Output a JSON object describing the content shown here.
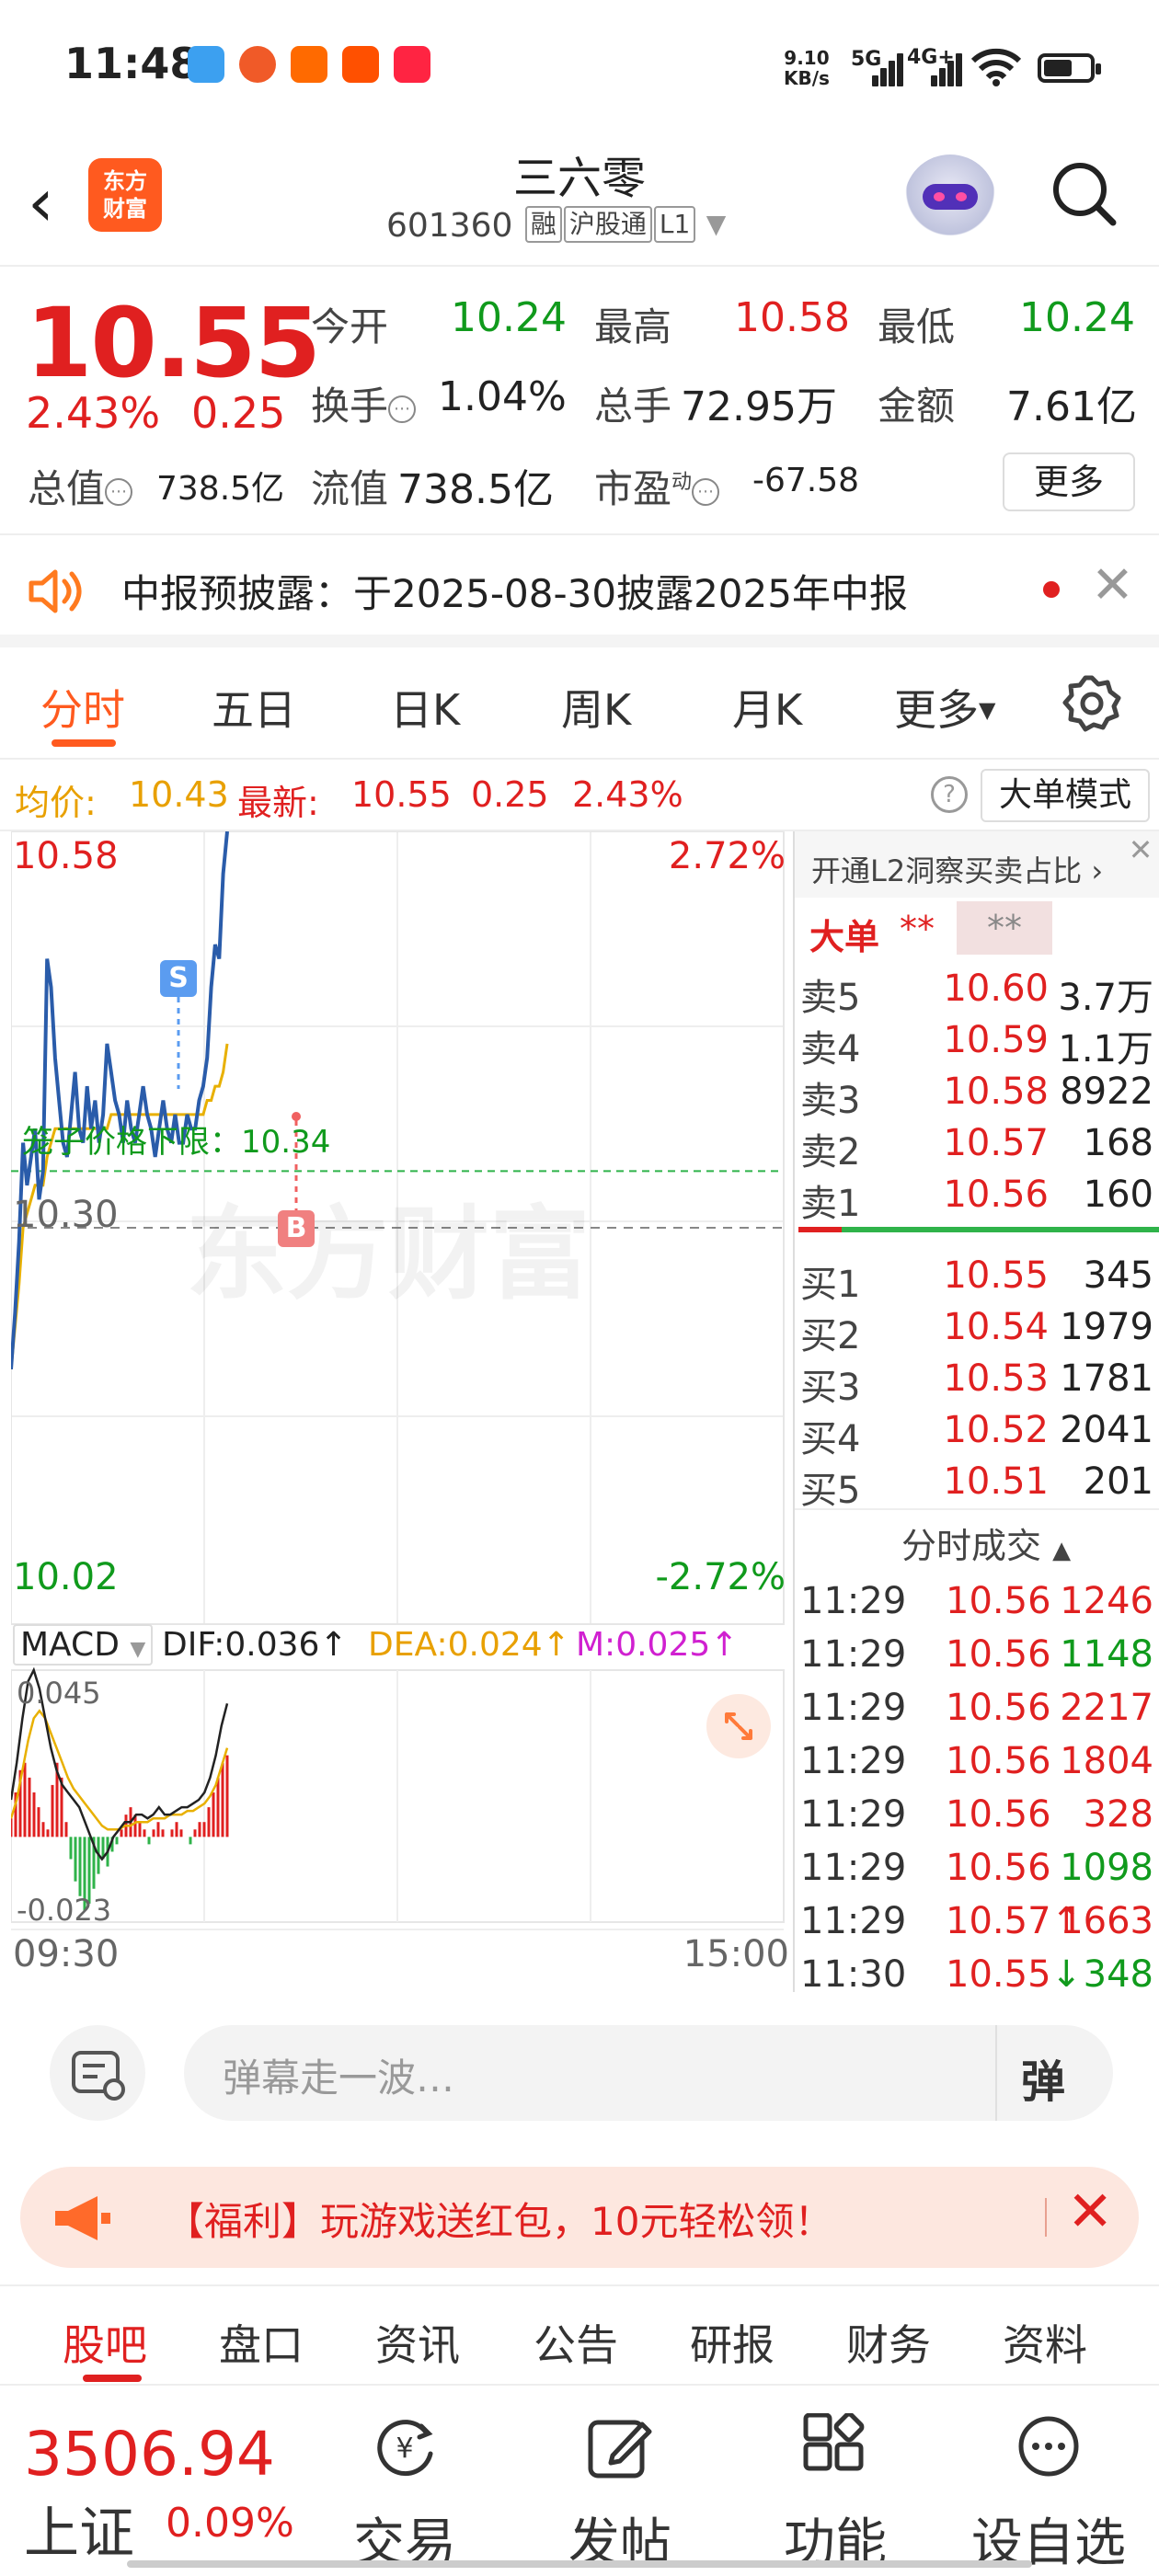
{
  "status_bar": {
    "time": "11:48",
    "net_speed_value": "9.10",
    "net_speed_unit": "KB/s",
    "sig1": "5G",
    "sig2": "4G+",
    "battery_level": 0.5
  },
  "header": {
    "logo_line1": "东方",
    "logo_line2": "财富",
    "stock_name": "三六零",
    "stock_code": "601360",
    "tags": [
      "融",
      "沪股通",
      "L1"
    ]
  },
  "quote": {
    "price": "10.55",
    "change_pct": "2.43%",
    "change": "0.25",
    "open_label": "今开",
    "open_value": "10.24",
    "high_label": "最高",
    "high_value": "10.58",
    "low_label": "最低",
    "low_value": "10.24",
    "turnover_label": "换手",
    "turnover_value": "1.04%",
    "volume_label": "总手",
    "volume_value": "72.95万",
    "amount_label": "金额",
    "amount_value": "7.61亿",
    "total_cap_label": "总值",
    "total_cap_value": "738.5亿",
    "float_cap_label": "流值",
    "float_cap_value": "738.5亿",
    "pe_label": "市盈",
    "pe_sup": "动",
    "pe_value": "-67.58",
    "more_button": "更多"
  },
  "notice": {
    "text": "中报预披露：于2025-08-30披露2025年中报",
    "close": "✕"
  },
  "chart_tabs": [
    "分时",
    "五日",
    "日K",
    "周K",
    "月K",
    "更多"
  ],
  "info_line": {
    "avg_label": "均价:",
    "avg_value": "10.43",
    "latest_label": "最新:",
    "latest_value": "10.55",
    "change": "0.25",
    "change_pct": "2.43%",
    "help": "?",
    "big_order_mode": "大单模式"
  },
  "chart_labels": {
    "top_price": "10.58",
    "top_pct": "2.72%",
    "mid_price": "10.30",
    "bottom_price": "10.02",
    "bottom_pct": "-2.72%",
    "limit_text": "笼子价格下限：10.34",
    "marker_s": "S",
    "marker_b": "B",
    "watermark": "东方财富",
    "macd_name": "MACD",
    "dif": "DIF:0.036",
    "dea": "DEA:0.024",
    "m": "M:0.025",
    "macd_top": "0.045",
    "macd_bottom": "-0.023",
    "time_start": "09:30",
    "time_end": "15:00"
  },
  "chart_data": {
    "type": "line",
    "title": "",
    "xlabel": "",
    "ylabel": "",
    "ylim": [
      10.02,
      10.58
    ],
    "x_range": [
      "09:30",
      "15:00"
    ],
    "series": [
      {
        "name": "",
        "values": [
          10.2,
          10.24,
          10.29,
          10.36,
          10.33,
          10.35,
          10.37,
          10.32,
          10.34,
          10.49,
          10.47,
          10.42,
          10.39,
          10.36,
          10.35,
          10.38,
          10.41,
          10.37,
          10.36,
          10.4,
          10.37,
          10.39,
          10.36,
          10.38,
          10.43,
          10.41,
          10.39,
          10.38,
          10.36,
          10.39,
          10.37,
          10.36,
          10.38,
          10.4,
          10.38,
          10.37,
          10.35,
          10.37,
          10.39,
          10.37,
          10.36,
          10.38,
          10.36,
          10.36,
          10.38,
          10.37,
          10.37,
          10.39,
          10.4,
          10.42,
          10.47,
          10.5,
          10.49,
          10.55,
          10.58
        ]
      },
      {
        "name": "",
        "values": [
          10.2,
          10.23,
          10.26,
          10.3,
          10.31,
          10.32,
          10.33,
          10.33,
          10.33,
          10.35,
          10.36,
          10.37,
          10.37,
          10.37,
          10.37,
          10.37,
          10.37,
          10.37,
          10.37,
          10.37,
          10.37,
          10.37,
          10.37,
          10.37,
          10.37,
          10.38,
          10.38,
          10.38,
          10.38,
          10.38,
          10.38,
          10.38,
          10.38,
          10.38,
          10.38,
          10.38,
          10.38,
          10.38,
          10.38,
          10.38,
          10.38,
          10.38,
          10.38,
          10.38,
          10.38,
          10.38,
          10.38,
          10.38,
          10.38,
          10.39,
          10.39,
          10.4,
          10.4,
          10.41,
          10.43
        ]
      }
    ],
    "reference_line": 10.3,
    "lower_limit": 10.34,
    "macd": {
      "ylim": [
        -0.023,
        0.045
      ],
      "histogram": [
        0.005,
        0.012,
        0.018,
        0.02,
        0.016,
        0.012,
        0.008,
        0.004,
        0.002,
        0.014,
        0.02,
        0.016,
        0.004,
        -0.006,
        -0.012,
        -0.016,
        -0.02,
        -0.018,
        -0.014,
        -0.01,
        -0.006,
        -0.008,
        -0.004,
        -0.002,
        0.002,
        0.006,
        0.008,
        0.006,
        0.004,
        0.002,
        -0.002,
        0.002,
        0.004,
        0.002,
        0,
        0.002,
        0.004,
        0.002,
        0,
        -0.002,
        0.002,
        0.004,
        0.004,
        0.008,
        0.012,
        0.016,
        0.02,
        0.022
      ],
      "dif": [
        0.01,
        0.02,
        0.032,
        0.042,
        0.045,
        0.04,
        0.032,
        0.024,
        0.018,
        0.014,
        0.012,
        0.01,
        0.008,
        0.004,
        0.0,
        -0.004,
        -0.006,
        -0.004,
        0.0,
        0.002,
        0.004,
        0.004,
        0.006,
        0.006,
        0.005,
        0.006,
        0.008,
        0.006,
        0.006,
        0.007,
        0.008,
        0.008,
        0.009,
        0.01,
        0.012,
        0.016,
        0.022,
        0.03,
        0.036
      ],
      "dea": [
        0.005,
        0.01,
        0.018,
        0.026,
        0.032,
        0.034,
        0.032,
        0.028,
        0.024,
        0.02,
        0.016,
        0.013,
        0.011,
        0.009,
        0.007,
        0.005,
        0.003,
        0.002,
        0.002,
        0.002,
        0.003,
        0.003,
        0.004,
        0.004,
        0.004,
        0.005,
        0.005,
        0.005,
        0.006,
        0.006,
        0.006,
        0.007,
        0.007,
        0.008,
        0.009,
        0.011,
        0.014,
        0.019,
        0.024
      ]
    }
  },
  "order_book": {
    "l2_banner": "开通L2洞察买卖占比",
    "big_order_label": "大单",
    "big_order_stars": "**",
    "big_order_box": "**",
    "asks": [
      {
        "label": "卖5",
        "price": "10.60",
        "volume": "3.7万"
      },
      {
        "label": "卖4",
        "price": "10.59",
        "volume": "1.1万"
      },
      {
        "label": "卖3",
        "price": "10.58",
        "volume": "8922"
      },
      {
        "label": "卖2",
        "price": "10.57",
        "volume": "168"
      },
      {
        "label": "卖1",
        "price": "10.56",
        "volume": "160"
      }
    ],
    "bids": [
      {
        "label": "买1",
        "price": "10.55",
        "volume": "345"
      },
      {
        "label": "买2",
        "price": "10.54",
        "volume": "1979"
      },
      {
        "label": "买3",
        "price": "10.53",
        "volume": "1781"
      },
      {
        "label": "买4",
        "price": "10.52",
        "volume": "2041"
      },
      {
        "label": "买5",
        "price": "10.51",
        "volume": "201"
      }
    ],
    "ticks_title": "分时成交",
    "ticks": [
      {
        "time": "11:29",
        "price": "10.56",
        "volume": "1246",
        "arrow": ""
      },
      {
        "time": "11:29",
        "price": "10.56",
        "volume": "1148",
        "arrow": ""
      },
      {
        "time": "11:29",
        "price": "10.56",
        "volume": "2217",
        "arrow": ""
      },
      {
        "time": "11:29",
        "price": "10.56",
        "volume": "1804",
        "arrow": ""
      },
      {
        "time": "11:29",
        "price": "10.56",
        "volume": "328",
        "arrow": ""
      },
      {
        "time": "11:29",
        "price": "10.56",
        "volume": "1098",
        "arrow": ""
      },
      {
        "time": "11:29",
        "price": "10.57",
        "volume": "1663",
        "arrow": "↑"
      },
      {
        "time": "11:30",
        "price": "10.55",
        "volume": "348",
        "arrow": "↓"
      }
    ]
  },
  "danmu": {
    "placeholder": "弹幕走一波…",
    "toggle": "弹"
  },
  "promo": {
    "text": "【福利】玩游戏送红包，10元轻松领！"
  },
  "bottom_tabs": [
    "股吧",
    "盘口",
    "资讯",
    "公告",
    "研报",
    "财务",
    "资料"
  ],
  "bottom_nav": {
    "index_value": "3506.94",
    "index_name": "上证",
    "index_pct": "0.09%",
    "trade": "交易",
    "post": "发帖",
    "features": "功能",
    "watchlist": "设自选"
  },
  "colors": {
    "accent": "#ff5a1f",
    "up": "#e02020",
    "down": "#109a1c",
    "price_line": "#2a5caa",
    "avg_line": "#e8b000"
  }
}
